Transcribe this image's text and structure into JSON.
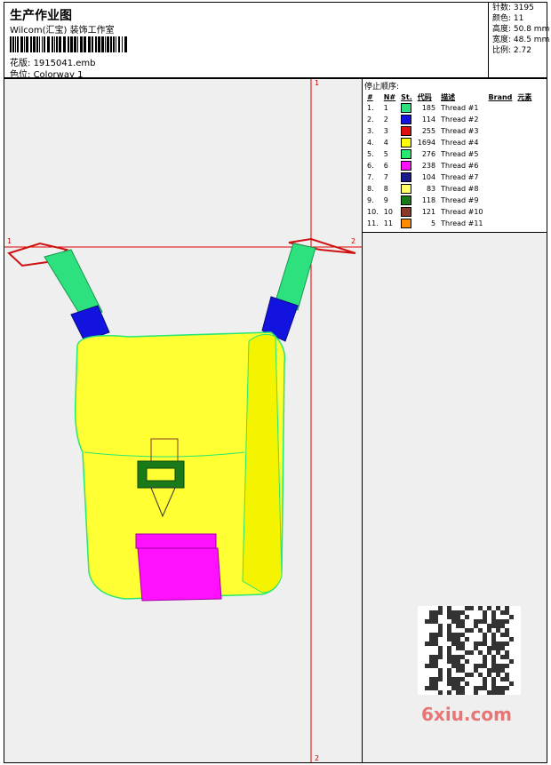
{
  "header": {
    "title": "生产作业图",
    "studio": "Wilcom(汇宝) 装饰工作室",
    "design_file_label": "花版:",
    "design_file": "1915041.emb",
    "colorway_label": "色位:",
    "colorway": "Colorway 1"
  },
  "stats": [
    {
      "label": "针数:",
      "value": "3195"
    },
    {
      "label": "颜色:",
      "value": "11"
    },
    {
      "label": "高度:",
      "value": "50.8 mm"
    },
    {
      "label": "宽度:",
      "value": "48.5 mm"
    },
    {
      "label": "比例:",
      "value": "2.72"
    }
  ],
  "sequence": {
    "title": "停止顺序:",
    "headers": [
      "#",
      "N#",
      "St.",
      "代码",
      "描述",
      "Brand",
      "元素"
    ],
    "rows": [
      {
        "idx": "1.",
        "n": "1",
        "st": "185",
        "desc": "Thread #1",
        "color": "#2ee17f"
      },
      {
        "idx": "2.",
        "n": "2",
        "st": "114",
        "desc": "Thread #2",
        "color": "#1313e0"
      },
      {
        "idx": "3.",
        "n": "3",
        "st": "255",
        "desc": "Thread #3",
        "color": "#e01010"
      },
      {
        "idx": "4.",
        "n": "4",
        "st": "1694",
        "desc": "Thread #4",
        "color": "#ffff00"
      },
      {
        "idx": "5.",
        "n": "5",
        "st": "276",
        "desc": "Thread #5",
        "color": "#28e870"
      },
      {
        "idx": "6.",
        "n": "6",
        "st": "238",
        "desc": "Thread #6",
        "color": "#ff10ff"
      },
      {
        "idx": "7.",
        "n": "7",
        "st": "104",
        "desc": "Thread #7",
        "color": "#1a1a8c"
      },
      {
        "idx": "8.",
        "n": "8",
        "st": "83",
        "desc": "Thread #8",
        "color": "#ffff66"
      },
      {
        "idx": "9.",
        "n": "9",
        "st": "118",
        "desc": "Thread #9",
        "color": "#1a7a1a"
      },
      {
        "idx": "10.",
        "n": "10",
        "st": "121",
        "desc": "Thread #10",
        "color": "#8b3a2a"
      },
      {
        "idx": "11.",
        "n": "11",
        "st": "5",
        "desc": "Thread #11",
        "color": "#ff8c00"
      }
    ]
  },
  "axis_labels": {
    "top": "1",
    "bottom": "2",
    "left": "1",
    "right": "2"
  },
  "watermark": "6xiu.com"
}
